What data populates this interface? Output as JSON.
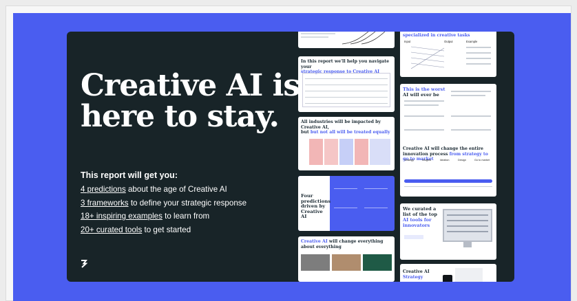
{
  "hero": {
    "title": "Creative AI is here to stay.",
    "subtitle": "This report will get you:",
    "bullets": [
      {
        "link": "4 predictions",
        "rest": " about the age of Creative AI"
      },
      {
        "link": "3 frameworks",
        "rest": " to define your strategic response"
      },
      {
        "link": "18+ inspiring examples",
        "rest": " to learn from"
      },
      {
        "link": "20+ curated tools",
        "rest": " to get started"
      }
    ]
  },
  "slides": {
    "navigate": {
      "title_a": "In this report we'll help you navigate your",
      "title_b": "strategic response to Creative AI"
    },
    "industries": {
      "title_a": "All industries will be impacted by Creative AI,",
      "title_b": "but not all will be treated equally"
    },
    "predictions": {
      "title": "Four predictions driven by Creative AI"
    },
    "everything": {
      "title_a": "Creative AI",
      "title_b": " will change everything about everything"
    },
    "specialized": {
      "title": "specialized in creative tasks",
      "col_input": "Input",
      "col_output": "Output",
      "col_example": "Example"
    },
    "worst": {
      "title_a": "This is the worst",
      "title_b": "AI will ever be"
    },
    "innovation": {
      "title_a": "Creative AI will change the entire innovation process ",
      "title_b": "from strategy to go to market",
      "cols": [
        "Strategy",
        "Insights",
        "Ideation",
        "Design",
        "Go to market"
      ]
    },
    "tools": {
      "title_a": "We curated a list of the top ",
      "title_b": "AI tools for innovators"
    },
    "strategy": {
      "title_a": "Creative AI",
      "title_b": "Strategy"
    }
  },
  "colors": {
    "accent": "#4a5df0",
    "card": "#182428"
  }
}
